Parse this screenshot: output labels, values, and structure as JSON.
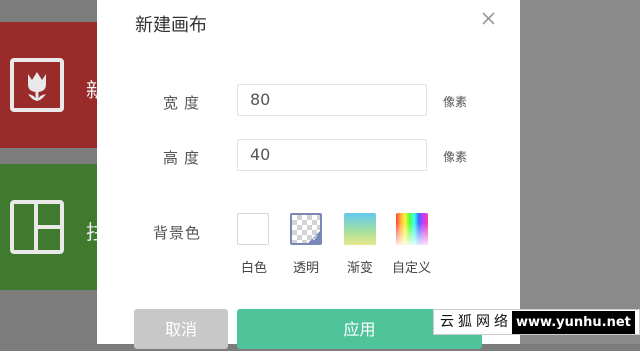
{
  "background": {
    "card1_char": "新",
    "card2_char": "拄"
  },
  "dialog": {
    "title": "新建画布",
    "close_icon": "close-icon",
    "width_label": "宽度",
    "width_value": "80",
    "width_unit": "像素",
    "height_label": "高度",
    "height_value": "40",
    "height_unit": "像素",
    "bg_label": "背景色",
    "swatches": [
      {
        "label": "白色",
        "selected": false
      },
      {
        "label": "透明",
        "selected": true
      },
      {
        "label": "渐变",
        "selected": false
      },
      {
        "label": "自定义",
        "selected": false
      }
    ],
    "cancel_label": "取消",
    "apply_label": "应用"
  },
  "watermark": {
    "text": "云狐网络",
    "url": "www.yunhu.net"
  },
  "colors": {
    "accent": "#4fc49a",
    "cancel": "#c8c8c8",
    "selected_border": "#7a88b8"
  }
}
